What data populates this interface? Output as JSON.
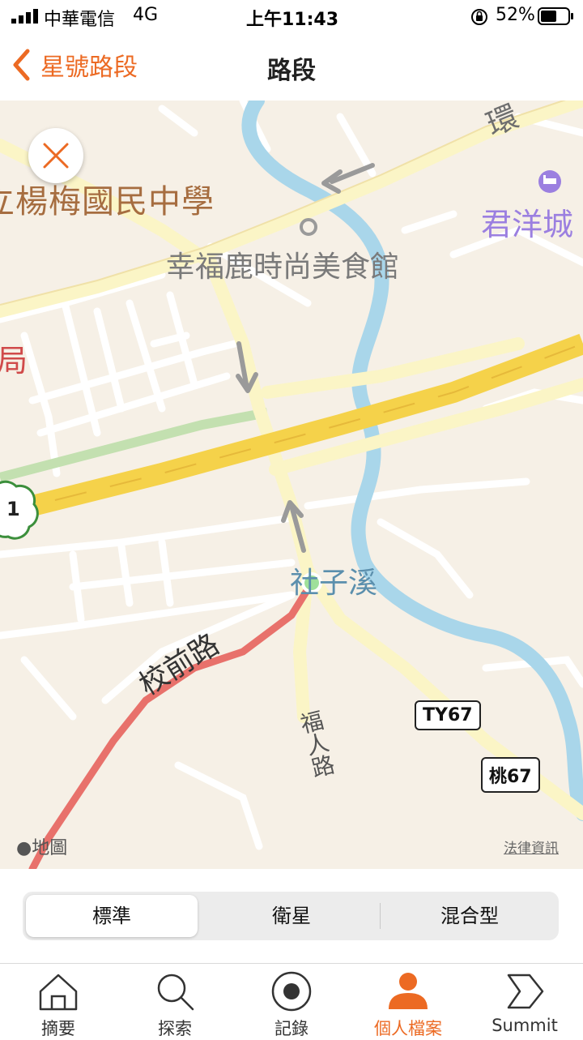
{
  "status_bar": {
    "carrier": "中華電信",
    "network": "4G",
    "time": "上午11:43",
    "battery": "52%"
  },
  "nav": {
    "back_label": "星號路段",
    "title": "路段"
  },
  "map": {
    "labels": {
      "school": "立楊梅國民中學",
      "restaurant": "幸福鹿時尚美食館",
      "hotel": "君洋城",
      "highway_prefix": "環",
      "office_fragment": "局",
      "creek": "社子溪",
      "road_xiaoqian": "校前路",
      "road_furen": "福人路",
      "freeway_number": "1",
      "attribution": "地圖",
      "legal": "法律資訊"
    },
    "shields": [
      "TY67",
      "桃67"
    ]
  },
  "segmented": {
    "options": [
      "標準",
      "衛星",
      "混合型"
    ],
    "selected": "標準"
  },
  "tabs": [
    {
      "label": "摘要",
      "icon": "home-icon"
    },
    {
      "label": "探索",
      "icon": "search-icon"
    },
    {
      "label": "記錄",
      "icon": "record-icon"
    },
    {
      "label": "個人檔案",
      "icon": "profile-icon",
      "active": true
    },
    {
      "label": "Summit",
      "icon": "summit-icon"
    }
  ],
  "colors": {
    "accent": "#ec6a23",
    "route": "#e8716b",
    "water": "#a9d6ea",
    "freeway": "#f5d24a"
  }
}
